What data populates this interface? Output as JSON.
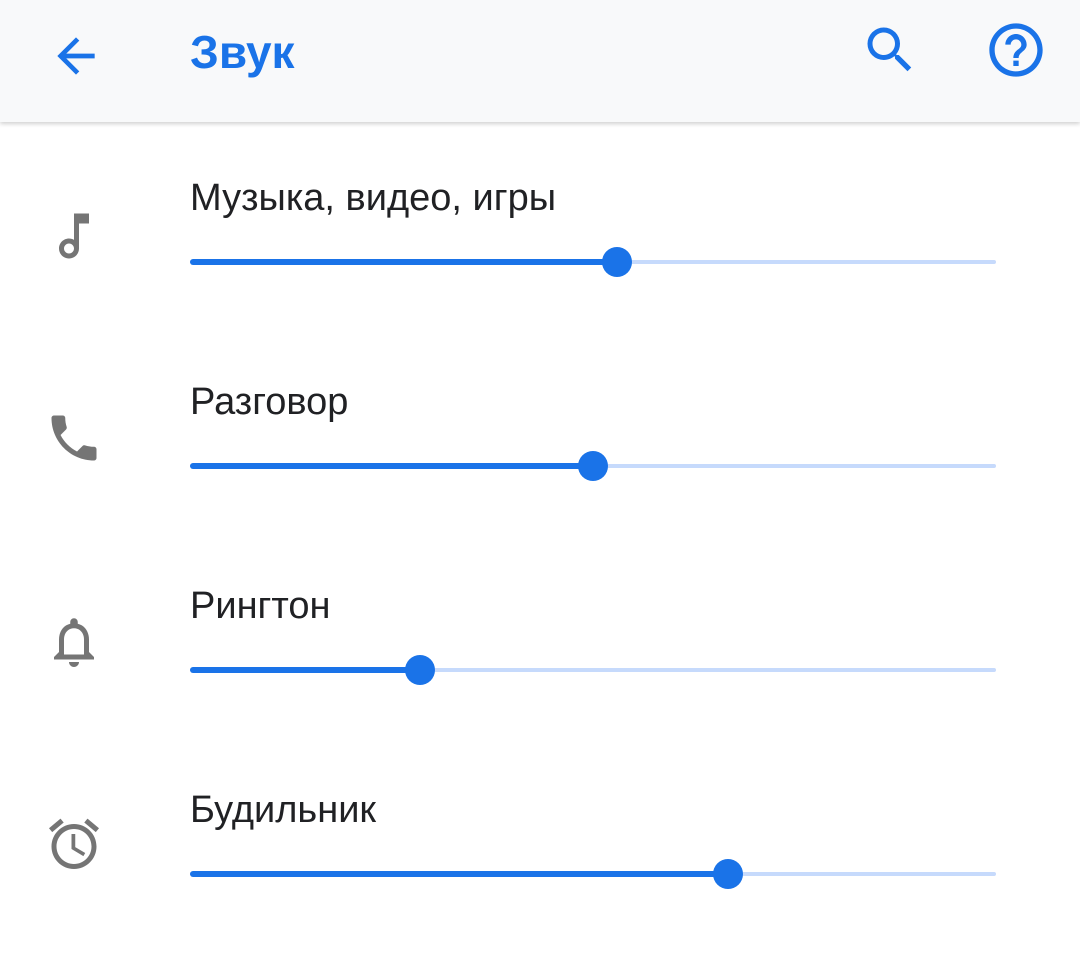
{
  "app_bar": {
    "title": "Звук",
    "back_icon": "arrow-back-icon",
    "search_icon": "search-icon",
    "help_icon": "help-circle-icon",
    "accent_color": "#1a73e8"
  },
  "volume_rows": [
    {
      "label": "Музыка, видео, игры",
      "icon": "music-note-icon",
      "level": 0.53
    },
    {
      "label": "Разговор",
      "icon": "phone-icon",
      "level": 0.5
    },
    {
      "label": "Рингтон",
      "icon": "bell-icon",
      "level": 0.285
    },
    {
      "label": "Будильник",
      "icon": "alarm-clock-icon",
      "level": 0.667
    }
  ],
  "colors": {
    "slider_active": "#1a73e8",
    "slider_inactive": "#c6dafc",
    "icon_gray": "#757575",
    "text": "#202124"
  }
}
